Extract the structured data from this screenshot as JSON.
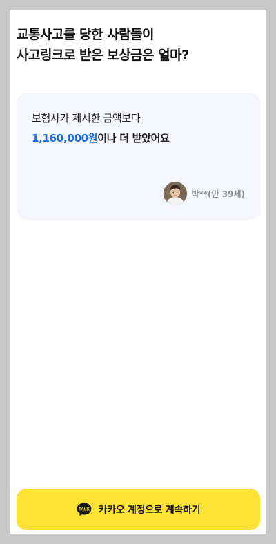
{
  "headline": {
    "line1": "교통사고를 당한 사람들이",
    "line2": "사고링크로 받은 보상금은 얼마?"
  },
  "review": {
    "line1": "보험사가 제시한 금액보다",
    "amount": "1,160,000원",
    "line2_rest": "이나 더 받았어요",
    "reviewer": "박**(만 39세)",
    "avatar_icon": "user-avatar-photo"
  },
  "kakao_button": {
    "label": "카카오 계정으로 계속하기",
    "icon_text": "TALK",
    "icon": "kakao-talk-icon",
    "color": "#fee234"
  },
  "colors": {
    "accent_blue": "#1d6fe0",
    "card_bg": "#f4f6fb",
    "frame_bg": "#c8c8c8"
  }
}
